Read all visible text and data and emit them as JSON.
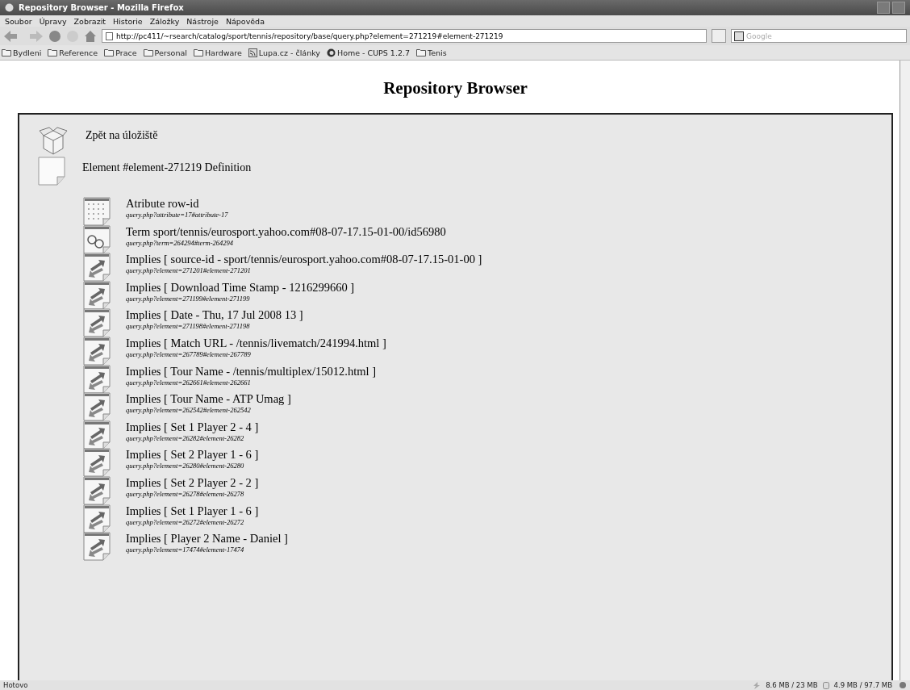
{
  "window": {
    "title": "Repository Browser - Mozilla Firefox"
  },
  "menu": [
    "Soubor",
    "Úpravy",
    "Zobrazit",
    "Historie",
    "Záložky",
    "Nástroje",
    "Nápověda"
  ],
  "address": {
    "value": "http://pc411/~rsearch/catalog/sport/tennis/repository/base/query.php?element=271219#element-271219"
  },
  "search": {
    "placeholder": "Google"
  },
  "bookmarks": [
    {
      "label": "Bydleni",
      "kind": "folder"
    },
    {
      "label": "Reference",
      "kind": "folder"
    },
    {
      "label": "Prace",
      "kind": "folder"
    },
    {
      "label": "Personal",
      "kind": "folder"
    },
    {
      "label": "Hardware",
      "kind": "folder"
    },
    {
      "label": "Lupa.cz - články",
      "kind": "feed"
    },
    {
      "label": "Home - CUPS 1.2.7",
      "kind": "site"
    },
    {
      "label": "Tenis",
      "kind": "folder"
    }
  ],
  "page": {
    "heading": "Repository Browser",
    "back_link": "Zpět na úložiště",
    "definition": "Element #element-271219 Definition",
    "items": [
      {
        "kind": "attribute",
        "title": "Atribute row-id",
        "link": "query.php?attribute=17#attribute-17"
      },
      {
        "kind": "term",
        "title": "Term sport/tennis/eurosport.yahoo.com#08-07-17.15-01-00/id56980",
        "link": "query.php?term=264294#term-264294"
      },
      {
        "kind": "implies",
        "title": "Implies [ source-id - sport/tennis/eurosport.yahoo.com#08-07-17.15-01-00 ]",
        "link": "query.php?element=271201#element-271201"
      },
      {
        "kind": "implies",
        "title": "Implies [ Download Time Stamp - 1216299660 ]",
        "link": "query.php?element=271199#element-271199"
      },
      {
        "kind": "implies",
        "title": "Implies [ Date - Thu, 17 Jul 2008 13 ]",
        "link": "query.php?element=271198#element-271198"
      },
      {
        "kind": "implies",
        "title": "Implies [ Match URL - /tennis/livematch/241994.html ]",
        "link": "query.php?element=267789#element-267789"
      },
      {
        "kind": "implies",
        "title": "Implies [ Tour Name - /tennis/multiplex/15012.html ]",
        "link": "query.php?element=262661#element-262661"
      },
      {
        "kind": "implies",
        "title": "Implies [ Tour Name - ATP Umag ]",
        "link": "query.php?element=262542#element-262542"
      },
      {
        "kind": "implies",
        "title": "Implies [ Set 1 Player 2 - 4 ]",
        "link": "query.php?element=26282#element-26282"
      },
      {
        "kind": "implies",
        "title": "Implies [ Set 2 Player 1 - 6 ]",
        "link": "query.php?element=26280#element-26280"
      },
      {
        "kind": "implies",
        "title": "Implies [ Set 2 Player 2 - 2 ]",
        "link": "query.php?element=26278#element-26278"
      },
      {
        "kind": "implies",
        "title": "Implies [ Set 1 Player 1 - 6 ]",
        "link": "query.php?element=26272#element-26272"
      },
      {
        "kind": "implies",
        "title": "Implies [ Player 2 Name - Daniel ]",
        "link": "query.php?element=17474#element-17474"
      }
    ]
  },
  "status_bar": {
    "text": "Hotovo",
    "network": "8.6 MB / 23 MB",
    "memory": "4.9 MB / 97.7 MB"
  }
}
